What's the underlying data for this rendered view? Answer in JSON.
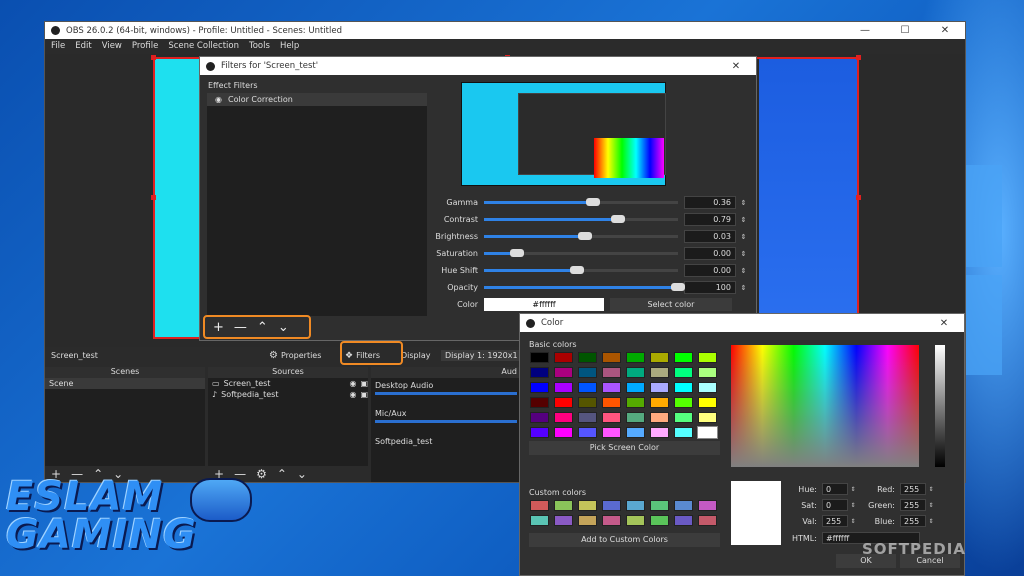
{
  "main_window": {
    "title": "OBS 26.0.2 (64-bit, windows) - Profile: Untitled - Scenes: Untitled",
    "controls": {
      "minimize": "—",
      "maximize": "☐",
      "close": "✕"
    },
    "menu": [
      "File",
      "Edit",
      "View",
      "Profile",
      "Scene Collection",
      "Tools",
      "Help"
    ]
  },
  "source_bar": {
    "source_name": "Screen_test",
    "properties_label": "Properties",
    "filters_label": "Filters",
    "display_label": "Display",
    "display_value": "Display 1: 1920x1"
  },
  "scenes": {
    "header": "Scenes",
    "items": [
      "Scene"
    ]
  },
  "sources": {
    "header": "Sources",
    "items": [
      "Screen_test",
      "Softpedia_test"
    ]
  },
  "audio": {
    "header": "Aud",
    "channels": [
      "Desktop Audio",
      "Mic/Aux",
      "Softpedia_test"
    ]
  },
  "filters_dialog": {
    "title": "Filters for 'Screen_test'",
    "effect_filters_label": "Effect Filters",
    "filters": [
      "Color Correction"
    ],
    "tools": {
      "add": "+",
      "remove": "—",
      "up": "⌃",
      "down": "⌄"
    },
    "controls": [
      {
        "label": "Gamma",
        "value": "0.36",
        "level": 0.56
      },
      {
        "label": "Contrast",
        "value": "0.79",
        "level": 0.69
      },
      {
        "label": "Brightness",
        "value": "0.03",
        "level": 0.52
      },
      {
        "label": "Saturation",
        "value": "0.00",
        "level": 0.17
      },
      {
        "label": "Hue Shift",
        "value": "0.00",
        "level": 0.48
      },
      {
        "label": "Opacity",
        "value": "100",
        "level": 1.0
      }
    ],
    "color_label": "Color",
    "color_value": "#ffffff",
    "select_color_label": "Select color"
  },
  "color_dialog": {
    "title": "Color",
    "basic_colors_label": "Basic colors",
    "basic_colors": [
      "#000000",
      "#aa0000",
      "#005500",
      "#aa5500",
      "#00aa00",
      "#aaaa00",
      "#00ff00",
      "#aaff00",
      "#00007f",
      "#aa007f",
      "#00557f",
      "#aa557f",
      "#00aa7f",
      "#aaaa7f",
      "#00ff7f",
      "#aaff7f",
      "#0000ff",
      "#aa00ff",
      "#0055ff",
      "#aa55ff",
      "#00aaff",
      "#aaaaff",
      "#00ffff",
      "#aaffff",
      "#550000",
      "#ff0000",
      "#555500",
      "#ff5500",
      "#55aa00",
      "#ffaa00",
      "#55ff00",
      "#ffff00",
      "#55007f",
      "#ff007f",
      "#55557f",
      "#ff557f",
      "#55aa7f",
      "#ffaa7f",
      "#55ff7f",
      "#ffff7f",
      "#5500ff",
      "#ff00ff",
      "#5555ff",
      "#ff55ff",
      "#55aaff",
      "#ffaaff",
      "#55ffff",
      "#ffffff"
    ],
    "pick_screen_color_label": "Pick Screen Color",
    "custom_colors_label": "Custom colors",
    "custom_colors": [
      "#d15a5a",
      "#8ac45a",
      "#c4c45a",
      "#5a6ad1",
      "#5aa8d1",
      "#5ac47a",
      "#5a8ad1",
      "#c45ac4",
      "#5ac4b4",
      "#8a5ac4",
      "#c4a45a",
      "#c45a8a",
      "#a4c45a",
      "#5ac45a",
      "#6a5ac4",
      "#c45a6a"
    ],
    "add_custom_label": "Add to Custom Colors",
    "hue_label": "Hue:",
    "hue": "0",
    "sat_label": "Sat:",
    "sat": "0",
    "val_label": "Val:",
    "val": "255",
    "red_label": "Red:",
    "red": "255",
    "green_label": "Green:",
    "green": "255",
    "blue_label": "Blue:",
    "blue": "255",
    "html_label": "HTML:",
    "html": "#ffffff",
    "ok_label": "OK",
    "cancel_label": "Cancel"
  },
  "branding": {
    "line1": "ESLAM",
    "line2": "GAMING",
    "watermark": "SOFTPEDIA"
  }
}
